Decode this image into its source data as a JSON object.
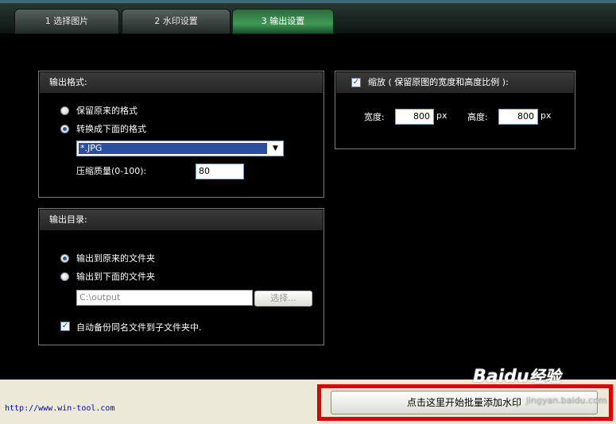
{
  "tabs": [
    {
      "label": "1 选择图片",
      "active": false
    },
    {
      "label": "2 水印设置",
      "active": false
    },
    {
      "label": "3 输出设置",
      "active": true
    }
  ],
  "output_format": {
    "title": "输出格式:",
    "option_keep": "保留原来的格式",
    "option_convert": "转换成下面的格式",
    "selected": "convert",
    "format_value": "*.JPG",
    "quality_label": "压缩质量(0-100):",
    "quality_value": "80"
  },
  "scale": {
    "checked": true,
    "label": "缩放 ( 保留原图的宽度和高度比例 ):",
    "width_label": "宽度:",
    "width_value": "800",
    "width_unit": "px",
    "height_label": "高度:",
    "height_value": "800",
    "height_unit": "px"
  },
  "output_dir": {
    "title": "输出目录:",
    "option_original": "输出到原来的文件夹",
    "option_below": "输出到下面的文件夹",
    "selected": "original",
    "path_value": "C:\\output",
    "browse_label": "选择...",
    "backup_checked": true,
    "backup_label": "自动备份同名文件到子文件夹中."
  },
  "footer": {
    "url": "http://www.win-tool.com",
    "start_button": "点击这里开始批量添加水印"
  },
  "watermark": {
    "logo_text": "Baidu",
    "logo_suffix": "经验",
    "site": "jingyan.baidu.com"
  },
  "colors": {
    "highlight": "#e00000",
    "active_tab": "#3e9a55"
  }
}
